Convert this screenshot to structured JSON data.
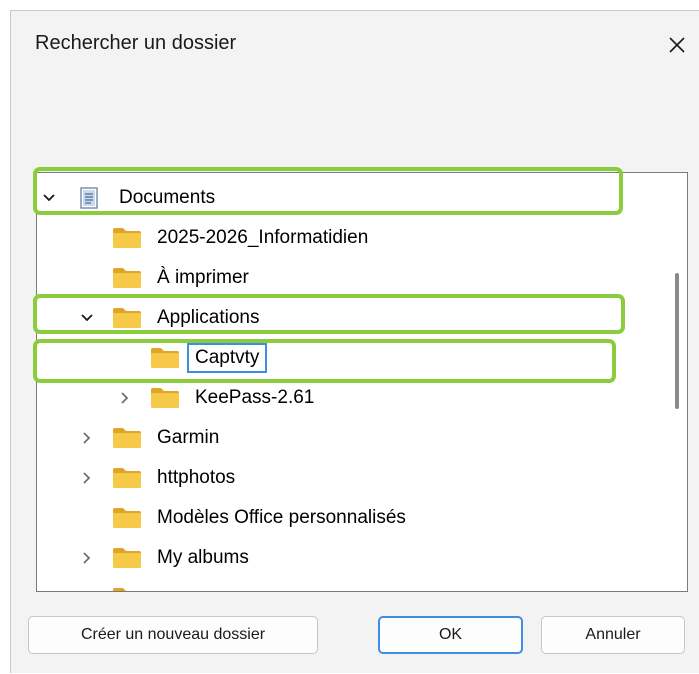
{
  "dialog": {
    "title": "Rechercher un dossier",
    "close_icon": "close-icon",
    "tree": {
      "items": [
        {
          "label": "Documents",
          "icon": "documents-library-icon",
          "expander": "expanded",
          "depth": 0
        },
        {
          "label": "2025-2026_Informatidien",
          "icon": "folder-icon",
          "expander": "none",
          "depth": 1
        },
        {
          "label": "À imprimer",
          "icon": "folder-icon",
          "expander": "none",
          "depth": 1
        },
        {
          "label": "Applications",
          "icon": "folder-icon",
          "expander": "expanded",
          "depth": 1
        },
        {
          "label": "Captvty",
          "icon": "folder-icon",
          "expander": "none",
          "depth": 2,
          "selected": true
        },
        {
          "label": "KeePass-2.61",
          "icon": "folder-icon",
          "expander": "collapsed",
          "depth": 2
        },
        {
          "label": "Garmin",
          "icon": "folder-icon",
          "expander": "collapsed",
          "depth": 1
        },
        {
          "label": "httphotos",
          "icon": "folder-icon",
          "expander": "collapsed",
          "depth": 1
        },
        {
          "label": "Modèles Office personnalisés",
          "icon": "folder-icon",
          "expander": "none",
          "depth": 1
        },
        {
          "label": "My albums",
          "icon": "folder-icon",
          "expander": "collapsed",
          "depth": 1
        }
      ]
    },
    "buttons": {
      "new_folder": "Créer un nouveau dossier",
      "ok": "OK",
      "cancel": "Annuler"
    }
  },
  "colors": {
    "highlight": "#8bcc3c",
    "selection_border": "#3d8ee6",
    "folder": "#f7c948"
  }
}
